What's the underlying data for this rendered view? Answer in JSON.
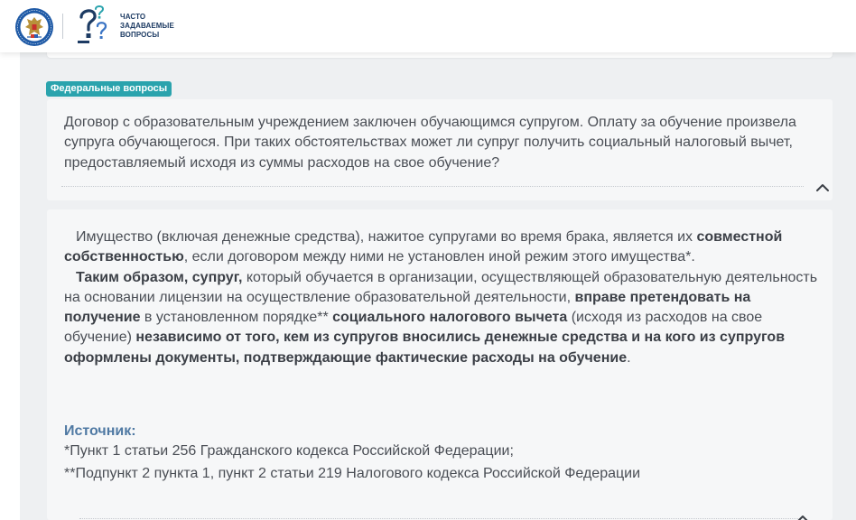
{
  "header": {
    "title_lines": [
      "ЧАСТО",
      "ЗАДАВАЕМЫЕ",
      "ВОПРОСЫ"
    ],
    "emblem_icon": "fns-emblem-icon",
    "faq_icon": "question-marks-icon"
  },
  "tag": {
    "label": "Федеральные вопросы",
    "color": "#2aa3ad"
  },
  "question": {
    "text": "Договор с образовательным учреждением заключен обучающимся супругом. Оплату за обучение произвела супруга обучающегося. При таких обстоятельствах может ли супруг получить социальный налоговый вычет, предоставляемый исходя из суммы расходов на свое обучение?",
    "toggle_icon": "chevron-up-icon"
  },
  "answer": {
    "p1_a": "Имущество (включая денежные средства), нажитое супругами во время брака, является их ",
    "p1_b": "совместной собственностью",
    "p1_c": ", если договором между ними не установлен иной режим этого имущества*.",
    "p2_a": "Таким образом, супруг,",
    "p2_b": " который обучается в организации, осуществляющей образовательную деятельность на основании лицензии на осуществление образовательной деятельности, ",
    "p2_c": "вправе претендовать на получение",
    "p2_d": " в установленном порядке** ",
    "p2_e": "социального налогового вычета",
    "p2_f": " (исходя из расходов на свое обучение) ",
    "p2_g": "независимо от того, кем из супругов вносились денежные средства и на кого из супругов оформлены документы, подтверждающие фактические расходы на обучение",
    "p2_h": ".",
    "source_title": "Источник:",
    "source_1": "*Пункт 1 статьи 256 Гражданского кодекса Российской Федерации;",
    "source_2": "**Подпункт 2 пункта 1, пункт 2 статьи 219 Налогового кодекса Российской Федерации",
    "accent_color": "#4f79a3"
  }
}
